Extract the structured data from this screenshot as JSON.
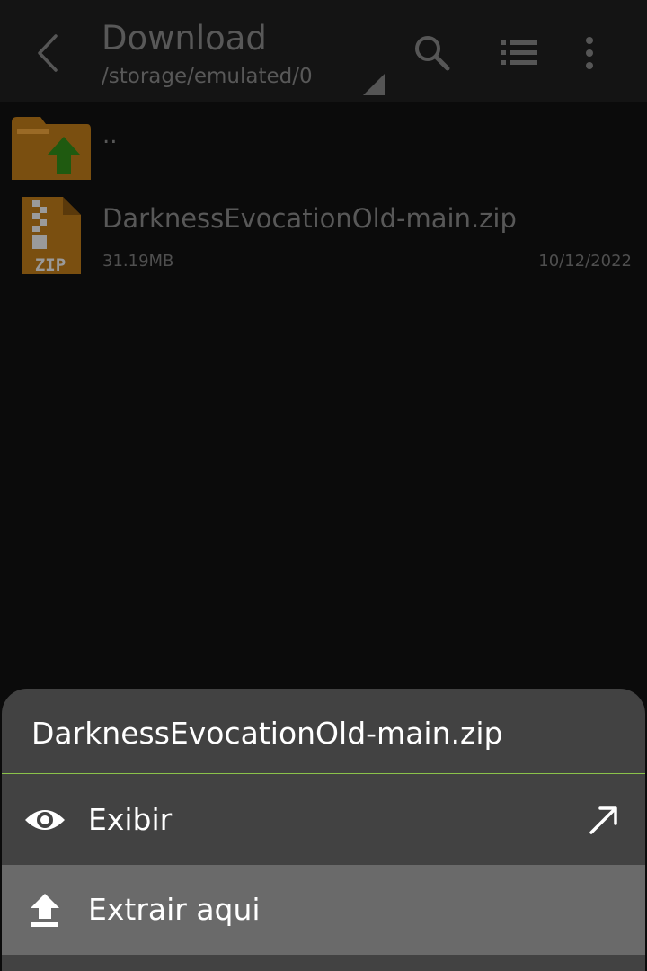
{
  "header": {
    "title": "Download",
    "path": "/storage/emulated/0",
    "icons": {
      "back": "back-icon",
      "dropdown": "dropdown-triangle-icon",
      "search": "search-icon",
      "list_view": "list-view-icon",
      "more": "more-vert-icon"
    }
  },
  "files": {
    "parent": {
      "label": "..",
      "icon": "folder-up-icon"
    },
    "items": [
      {
        "name": "DarknessEvocationOld-main.zip",
        "size": "31.19MB",
        "date": "10/12/2022",
        "icon": "zip-file-icon",
        "icon_text": "ZIP"
      }
    ]
  },
  "sheet": {
    "title": "DarknessEvocationOld-main.zip",
    "items": [
      {
        "label": "Exibir",
        "icon": "eye-icon",
        "trailing_icon": "open-external-icon"
      },
      {
        "label": "Extrair aqui",
        "icon": "extract-upload-icon"
      }
    ]
  },
  "colors": {
    "background": "#0b0b0b",
    "header_bg": "#141414",
    "dim_text": "#585858",
    "sheet_bg": "#424242",
    "selected_item_bg": "#6a6a6a",
    "divider_accent": "#8bc34a",
    "folder": "#7a4f10",
    "arrow": "#1f5a10"
  }
}
